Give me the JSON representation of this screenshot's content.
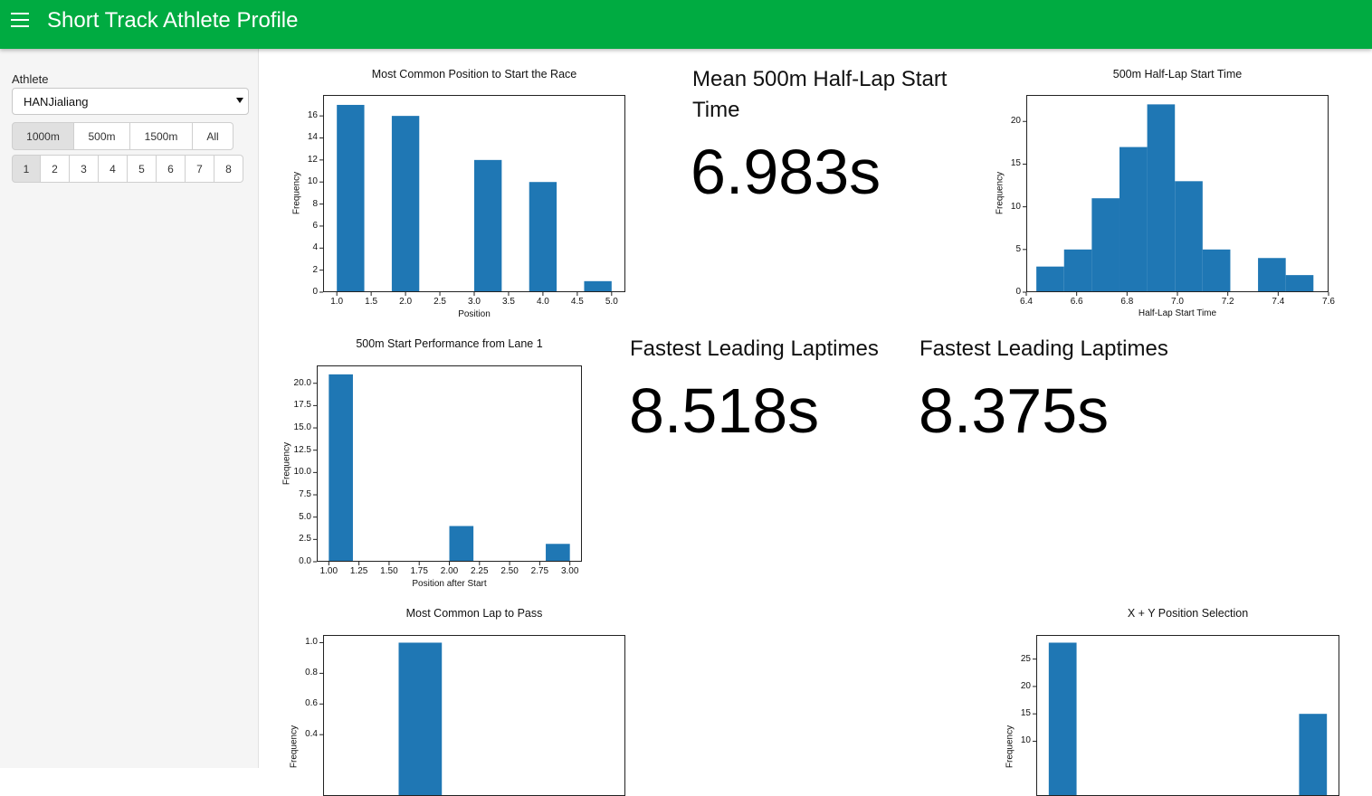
{
  "app": {
    "title": "Short Track Athlete Profile"
  },
  "sidebar": {
    "athlete_label": "Athlete",
    "athlete_value": "HANJialiang",
    "distances": [
      {
        "label": "1000m",
        "active": true
      },
      {
        "label": "500m",
        "active": false
      },
      {
        "label": "1500m",
        "active": false
      },
      {
        "label": "All",
        "active": false
      }
    ],
    "lanes": [
      {
        "label": "1",
        "active": true
      },
      {
        "label": "2",
        "active": false
      },
      {
        "label": "3",
        "active": false
      },
      {
        "label": "4",
        "active": false
      },
      {
        "label": "5",
        "active": false
      },
      {
        "label": "6",
        "active": false
      },
      {
        "label": "7",
        "active": false
      },
      {
        "label": "8",
        "active": false
      }
    ]
  },
  "stats": {
    "mean_half_lap": {
      "title": "Mean 500m Half-Lap Start Time",
      "value": "6.983s"
    },
    "fastest_1": {
      "title": "Fastest Leading Laptimes",
      "value": "8.518s"
    },
    "fastest_2": {
      "title": "Fastest Leading Laptimes",
      "value": "8.375s"
    }
  },
  "colors": {
    "accent": "#00ab41",
    "bar": "#1f77b4"
  },
  "chart_data": [
    {
      "id": "start-position",
      "type": "bar",
      "title": "Most Common Position to Start the Race",
      "xlabel": "Position",
      "ylabel": "Frequency",
      "xlim": [
        0.8,
        5.2
      ],
      "ylim": [
        0,
        17.9
      ],
      "xticks": [
        "1.0",
        "1.5",
        "2.0",
        "2.5",
        "3.0",
        "3.5",
        "4.0",
        "4.5",
        "5.0"
      ],
      "yticks": [
        "0",
        "2",
        "4",
        "6",
        "8",
        "10",
        "12",
        "14",
        "16"
      ],
      "bars": [
        {
          "x0": 1.0,
          "x1": 1.4,
          "y": 17
        },
        {
          "x0": 1.8,
          "x1": 2.2,
          "y": 16
        },
        {
          "x0": 3.0,
          "x1": 3.4,
          "y": 12
        },
        {
          "x0": 3.8,
          "x1": 4.2,
          "y": 10
        },
        {
          "x0": 4.6,
          "x1": 5.0,
          "y": 1
        }
      ]
    },
    {
      "id": "half-lap-start-time",
      "type": "bar",
      "title": "500m Half-Lap Start Time",
      "xlabel": "Half-Lap Start Time",
      "ylabel": "Frequency",
      "xlim": [
        6.4,
        7.6
      ],
      "ylim": [
        0,
        23.1
      ],
      "xticks": [
        "6.4",
        "6.6",
        "6.8",
        "7.0",
        "7.2",
        "7.4",
        "7.6"
      ],
      "yticks": [
        "0",
        "5",
        "10",
        "15",
        "20"
      ],
      "bars": [
        {
          "x0": 6.44,
          "x1": 6.55,
          "y": 3
        },
        {
          "x0": 6.55,
          "x1": 6.66,
          "y": 5
        },
        {
          "x0": 6.66,
          "x1": 6.77,
          "y": 11
        },
        {
          "x0": 6.77,
          "x1": 6.88,
          "y": 17
        },
        {
          "x0": 6.88,
          "x1": 6.99,
          "y": 22
        },
        {
          "x0": 6.99,
          "x1": 7.1,
          "y": 13
        },
        {
          "x0": 7.1,
          "x1": 7.21,
          "y": 5
        },
        {
          "x0": 7.32,
          "x1": 7.43,
          "y": 4
        },
        {
          "x0": 7.43,
          "x1": 7.54,
          "y": 2
        }
      ]
    },
    {
      "id": "lane1-start-performance",
      "type": "bar",
      "title": "500m Start Performance from Lane 1",
      "xlabel": "Position after Start",
      "ylabel": "Frequency",
      "xlim": [
        0.9,
        3.1
      ],
      "ylim": [
        0,
        22
      ],
      "xticks": [
        "1.00",
        "1.25",
        "1.50",
        "1.75",
        "2.00",
        "2.25",
        "2.50",
        "2.75",
        "3.00"
      ],
      "yticks": [
        "0.0",
        "2.5",
        "5.0",
        "7.5",
        "10.0",
        "12.5",
        "15.0",
        "17.5",
        "20.0"
      ],
      "bars": [
        {
          "x0": 1.0,
          "x1": 1.2,
          "y": 21
        },
        {
          "x0": 2.0,
          "x1": 2.2,
          "y": 4
        },
        {
          "x0": 2.8,
          "x1": 3.0,
          "y": 2
        }
      ]
    },
    {
      "id": "lap-to-pass",
      "type": "bar",
      "title": "Most Common Lap to Pass",
      "xlabel": "",
      "ylabel": "Frequency",
      "ylim": [
        0,
        1.05
      ],
      "yticks": [
        "0.4",
        "0.6",
        "0.8",
        "1.0"
      ],
      "bars": [
        {
          "x0": 0.0,
          "x1": 1.0,
          "y": 1.0
        }
      ]
    },
    {
      "id": "xy-position-selection",
      "type": "bar",
      "title": "X + Y Position Selection",
      "xlabel": "",
      "ylabel": "Frequency",
      "ylim": [
        0,
        29.4
      ],
      "yticks": [
        "10",
        "15",
        "20",
        "25"
      ],
      "bars": [
        {
          "x0": 0.0,
          "x1": 1.0,
          "y": 28
        },
        {
          "x0": 9.0,
          "x1": 10.0,
          "y": 15
        }
      ]
    }
  ]
}
